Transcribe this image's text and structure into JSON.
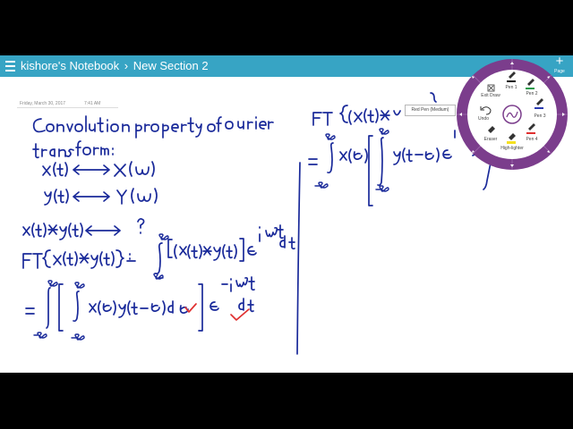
{
  "header": {
    "notebook": "kishore's Notebook",
    "separator": "›",
    "section": "New Section 2",
    "add_page_label": "Page",
    "add_page_symbol": "+"
  },
  "page_meta": {
    "date": "Friday, March 30, 2017",
    "time": "7:41 AM"
  },
  "radial_menu": {
    "tooltip": "Red Pen (Medium)",
    "items": {
      "exit_draw": "Exit Draw",
      "pen1": "Pen 1",
      "pen2": "Pen 2",
      "pen3": "Pen 3",
      "pen4": "Pen 4",
      "undo": "Undo",
      "eraser": "Eraser",
      "highlighter": "High-lighter"
    }
  },
  "colors": {
    "title_bar": "#37a4c4",
    "ink": "#1a2a9a",
    "check_mark": "#e03030",
    "radial_ring": "#7b3d8c"
  }
}
